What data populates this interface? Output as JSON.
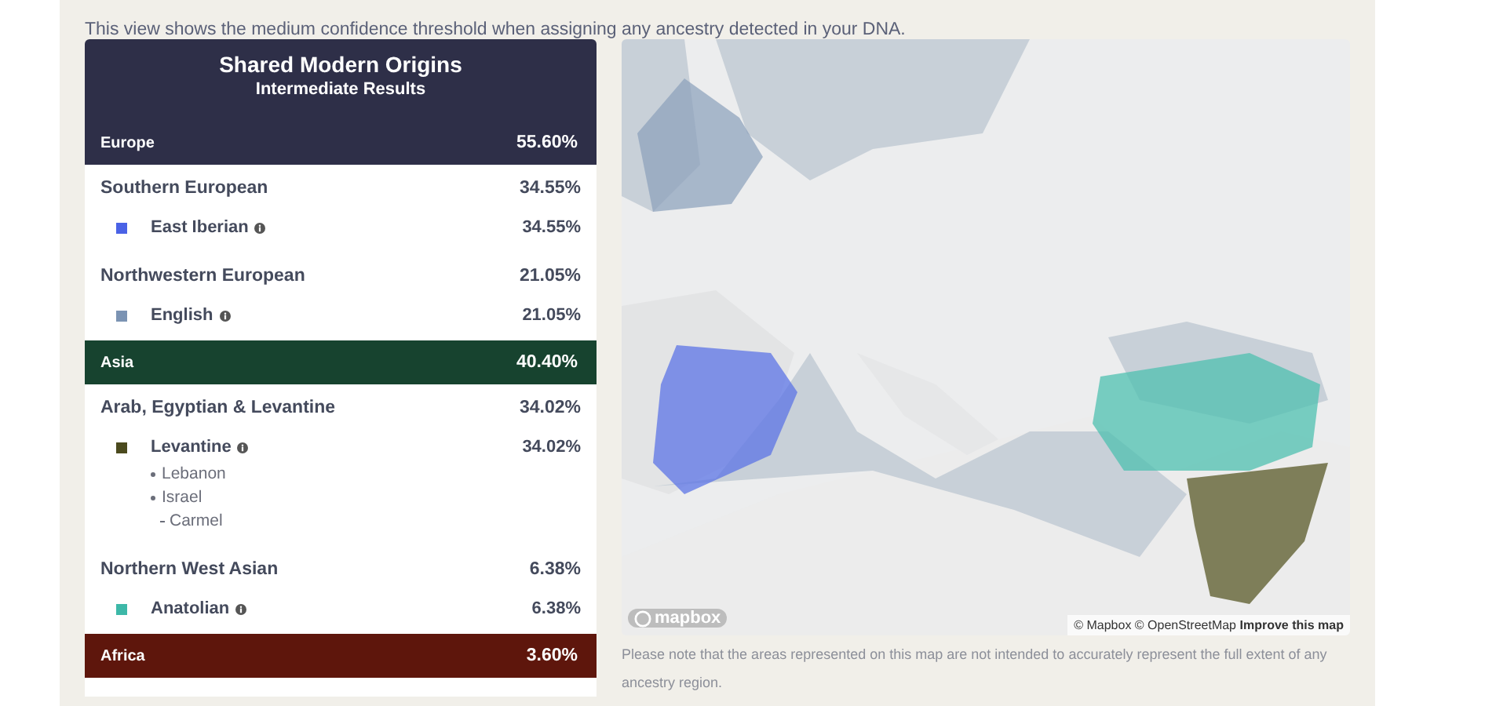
{
  "intro": "This view shows the medium confidence threshold when assigning any ancestry detected in your DNA.",
  "panel": {
    "title": "Shared Modern Origins",
    "subtitle": "Intermediate Results",
    "regions": [
      {
        "name": "Europe",
        "percent": "55.60%",
        "color": "#2e2f48",
        "groups": [
          {
            "name": "Southern European",
            "percent": "34.55%",
            "populations": [
              {
                "name": "East Iberian",
                "percent": "34.55%",
                "color": "#4a62e6"
              }
            ]
          },
          {
            "name": "Northwestern European",
            "percent": "21.05%",
            "populations": [
              {
                "name": "English",
                "percent": "21.05%",
                "color": "#7b93b3"
              }
            ]
          }
        ]
      },
      {
        "name": "Asia",
        "percent": "40.40%",
        "color": "#17432f",
        "groups": [
          {
            "name": "Arab, Egyptian & Levantine",
            "percent": "34.02%",
            "populations": [
              {
                "name": "Levantine",
                "percent": "34.02%",
                "color": "#4b4a1e",
                "places": [
                  {
                    "name": "Lebanon"
                  },
                  {
                    "name": "Israel",
                    "children": [
                      {
                        "name": "Carmel"
                      }
                    ]
                  }
                ]
              }
            ]
          },
          {
            "name": "Northern West Asian",
            "percent": "6.38%",
            "populations": [
              {
                "name": "Anatolian",
                "percent": "6.38%",
                "color": "#3db8a8"
              }
            ]
          }
        ]
      },
      {
        "name": "Africa",
        "percent": "3.60%",
        "color": "#5e160c"
      }
    ]
  },
  "map": {
    "logo": "mapbox",
    "attribution": "© Mapbox © OpenStreetMap",
    "improve_link": "Improve this map"
  },
  "note": "Please note that the areas represented on this map are not intended to accurately represent the full extent of any ancestry region."
}
